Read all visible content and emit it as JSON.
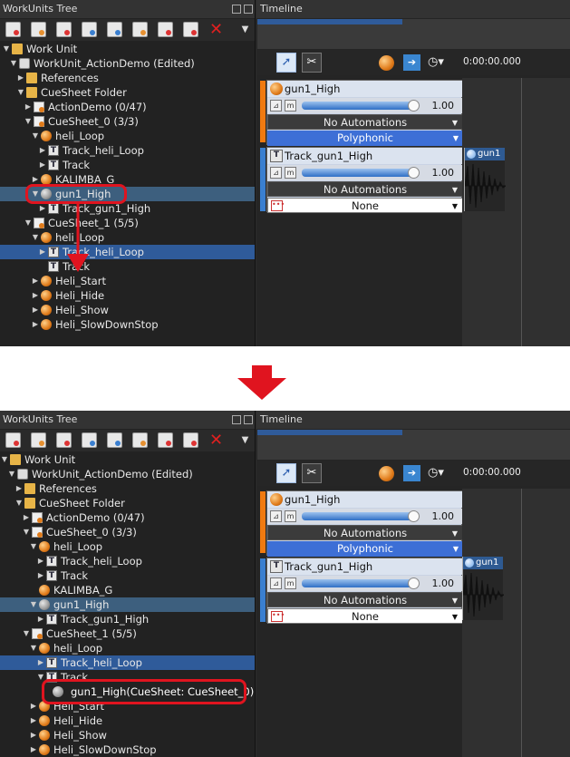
{
  "panels": {
    "tree_title": "WorkUnits Tree",
    "timeline_title": "Timeline",
    "timecode": "0:00:00.000"
  },
  "toolbar": {
    "icons": [
      "new-cue-sheet-icon",
      "new-cue-icon",
      "new-track-icon",
      "new-material-icon",
      "new-workunit-icon",
      "new-aisac-icon",
      "new-category-icon",
      "new-action-icon",
      "delete-icon",
      "menu-dropdown-icon"
    ]
  },
  "tree_top": [
    {
      "label": "Work Unit",
      "indent": 0,
      "arrow": "▼",
      "icon": "folder"
    },
    {
      "label": "WorkUnit_ActionDemo (Edited)",
      "indent": 1,
      "arrow": "▼",
      "icon": "wu"
    },
    {
      "label": "References",
      "indent": 2,
      "arrow": "▶",
      "icon": "folder"
    },
    {
      "label": "CueSheet Folder",
      "indent": 2,
      "arrow": "▼",
      "icon": "folder"
    },
    {
      "label": "ActionDemo (0/47)",
      "indent": 3,
      "arrow": "▶",
      "icon": "cs"
    },
    {
      "label": "CueSheet_0 (3/3)",
      "indent": 3,
      "arrow": "▼",
      "icon": "cs"
    },
    {
      "label": "heli_Loop",
      "indent": 4,
      "arrow": "▼",
      "icon": "orb"
    },
    {
      "label": "Track_heli_Loop",
      "indent": 5,
      "arrow": "▶",
      "icon": "trk"
    },
    {
      "label": "Track",
      "indent": 5,
      "arrow": "▶",
      "icon": "trk"
    },
    {
      "label": "KALIMBA_G",
      "indent": 4,
      "arrow": "▶",
      "icon": "orb"
    },
    {
      "label": "gun1_High",
      "indent": 4,
      "arrow": "▼",
      "icon": "orbg",
      "hl": true
    },
    {
      "label": "Track_gun1_High",
      "indent": 5,
      "arrow": "▶",
      "icon": "trk"
    },
    {
      "label": "CueSheet_1 (5/5)",
      "indent": 3,
      "arrow": "▼",
      "icon": "cs"
    },
    {
      "label": "heli_Loop",
      "indent": 4,
      "arrow": "▼",
      "icon": "orb"
    },
    {
      "label": "Track_heli_Loop",
      "indent": 5,
      "arrow": "▶",
      "icon": "trk",
      "sel": true
    },
    {
      "label": "Track",
      "indent": 5,
      "arrow": "",
      "icon": "trk"
    },
    {
      "label": "Heli_Start",
      "indent": 4,
      "arrow": "▶",
      "icon": "orb"
    },
    {
      "label": "Heli_Hide",
      "indent": 4,
      "arrow": "▶",
      "icon": "orb"
    },
    {
      "label": "Heli_Show",
      "indent": 4,
      "arrow": "▶",
      "icon": "orb"
    },
    {
      "label": "Heli_SlowDownStop",
      "indent": 4,
      "arrow": "▶",
      "icon": "orb"
    }
  ],
  "tree_bottom": [
    {
      "label": "Work Unit",
      "indent": 0,
      "arrow": "▼",
      "icon": "folder"
    },
    {
      "label": "WorkUnit_ActionDemo (Edited)",
      "indent": 1,
      "arrow": "▼",
      "icon": "wu"
    },
    {
      "label": "References",
      "indent": 2,
      "arrow": "▶",
      "icon": "folder"
    },
    {
      "label": "CueSheet Folder",
      "indent": 2,
      "arrow": "▼",
      "icon": "folder"
    },
    {
      "label": "ActionDemo (0/47)",
      "indent": 3,
      "arrow": "▶",
      "icon": "cs"
    },
    {
      "label": "CueSheet_0 (3/3)",
      "indent": 3,
      "arrow": "▼",
      "icon": "cs"
    },
    {
      "label": "heli_Loop",
      "indent": 4,
      "arrow": "▼",
      "icon": "orb"
    },
    {
      "label": "Track_heli_Loop",
      "indent": 5,
      "arrow": "▶",
      "icon": "trk"
    },
    {
      "label": "Track",
      "indent": 5,
      "arrow": "▶",
      "icon": "trk"
    },
    {
      "label": "KALIMBA_G",
      "indent": 4,
      "arrow": "",
      "icon": "orb"
    },
    {
      "label": "gun1_High",
      "indent": 4,
      "arrow": "▼",
      "icon": "orbg",
      "hl": true
    },
    {
      "label": "Track_gun1_High",
      "indent": 5,
      "arrow": "▶",
      "icon": "trk"
    },
    {
      "label": "CueSheet_1 (5/5)",
      "indent": 3,
      "arrow": "▼",
      "icon": "cs"
    },
    {
      "label": "heli_Loop",
      "indent": 4,
      "arrow": "▼",
      "icon": "orb"
    },
    {
      "label": "Track_heli_Loop",
      "indent": 5,
      "arrow": "▶",
      "icon": "trk",
      "sel": true
    },
    {
      "label": "Track",
      "indent": 5,
      "arrow": "▼",
      "icon": "trk"
    },
    {
      "label": "",
      "indent": 6,
      "arrow": "",
      "icon": "none"
    },
    {
      "label": "Heli_Start",
      "indent": 4,
      "arrow": "▶",
      "icon": "orb"
    },
    {
      "label": "Heli_Hide",
      "indent": 4,
      "arrow": "▶",
      "icon": "orb"
    },
    {
      "label": "Heli_Show",
      "indent": 4,
      "arrow": "▶",
      "icon": "orb"
    },
    {
      "label": "Heli_SlowDownStop",
      "indent": 4,
      "arrow": "▶",
      "icon": "orb"
    }
  ],
  "dragged_item": "gun1_High(CueSheet: CueSheet_0)",
  "timeline": {
    "cue_panel": {
      "name": "gun1_High",
      "volume": "1.00",
      "automation": "No Automations",
      "mode": "Polyphonic"
    },
    "track_panel": {
      "name": "Track_gun1_High",
      "volume": "1.00",
      "automation": "No Automations",
      "mode": "None"
    },
    "waveform_label": "gun1"
  },
  "colors": {
    "selection": "#2f5b9a",
    "highlight_row": "#3d5f7e",
    "annotation_red": "#e0141f",
    "cue_bar": "#f07a10",
    "track_bar": "#3a7fd0"
  }
}
